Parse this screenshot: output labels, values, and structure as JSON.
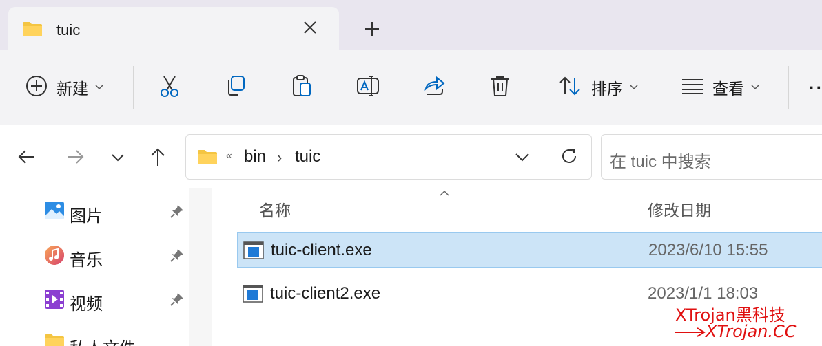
{
  "tab": {
    "title": "tuic",
    "new_tab_symbol": "+"
  },
  "toolbar": {
    "new_label": "新建",
    "sort_label": "排序",
    "view_label": "查看",
    "more_label": "··",
    "icons": [
      "plus-circle-icon",
      "cut-icon",
      "copy-icon",
      "paste-icon",
      "rename-icon",
      "share-icon",
      "delete-icon",
      "sort-icon",
      "view-icon"
    ]
  },
  "address": {
    "overflow": "«",
    "segments": [
      "bin",
      "tuic"
    ],
    "separator": "›"
  },
  "search": {
    "placeholder": "在 tuic 中搜索"
  },
  "sidebar": {
    "items": [
      {
        "label": "图片",
        "icon": "pictures-icon",
        "pinned": true
      },
      {
        "label": "音乐",
        "icon": "music-icon",
        "pinned": true
      },
      {
        "label": "视频",
        "icon": "videos-icon",
        "pinned": true
      },
      {
        "label": "私人文件",
        "icon": "folder-icon",
        "pinned": false
      }
    ]
  },
  "filelist": {
    "columns": {
      "name": "名称",
      "date": "修改日期"
    },
    "files": [
      {
        "name": "tuic-client.exe",
        "date": "2023/6/10 15:55",
        "selected": true
      },
      {
        "name": "tuic-client2.exe",
        "date": "2023/1/1 18:03",
        "selected": false
      }
    ]
  },
  "watermark": {
    "line1": "XTrojan黑科技",
    "line2": "XTrojan.CC"
  },
  "colors": {
    "selection": "#cce4f7",
    "selection_border": "#99c9ef",
    "folder": "#f4c542",
    "watermark": "#e01010",
    "accent": "#0067c0"
  }
}
